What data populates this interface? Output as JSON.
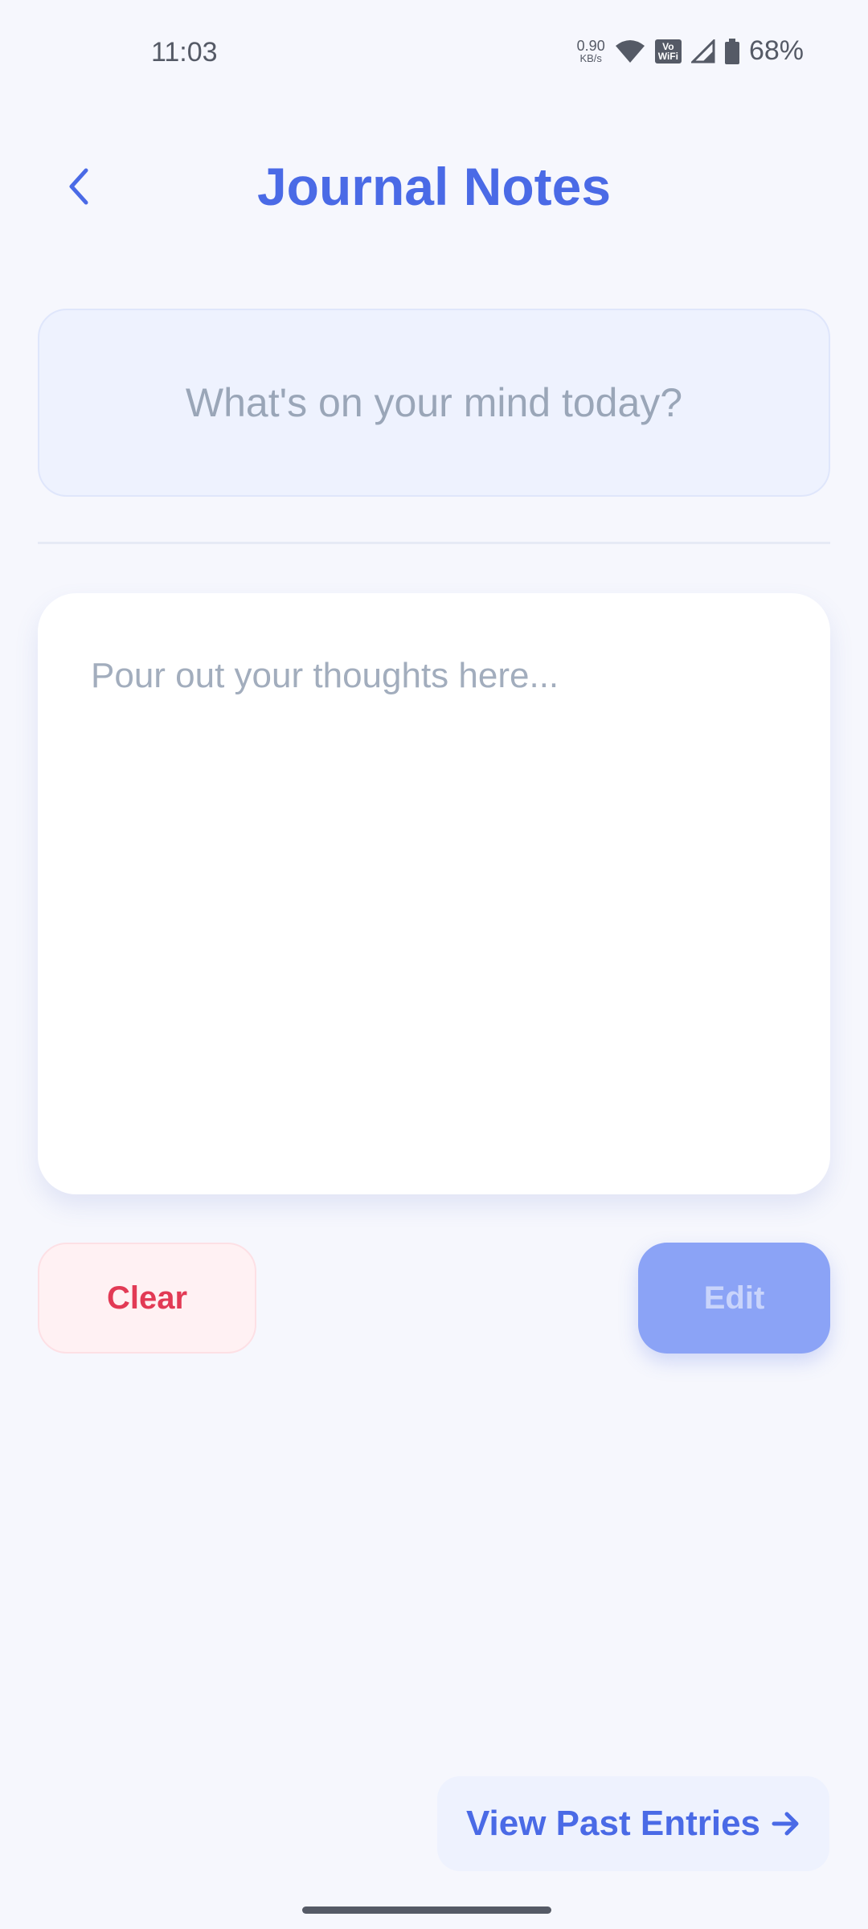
{
  "status_bar": {
    "time": "11:03",
    "net_speed_value": "0.90",
    "net_speed_unit": "KB/s",
    "vowifi_top": "Vo",
    "vowifi_bottom": "WiFi",
    "battery": "68%"
  },
  "header": {
    "title": "Journal Notes",
    "back_icon": "chevron-left-icon"
  },
  "prompt": {
    "text": "What's on your mind today?"
  },
  "entry": {
    "value": "",
    "placeholder": "Pour out your thoughts here..."
  },
  "actions": {
    "clear_label": "Clear",
    "edit_label": "Edit"
  },
  "footer": {
    "view_past_label": "View Past Entries",
    "view_past_icon": "arrow-right-icon"
  },
  "colors": {
    "accent": "#4a6ae6",
    "danger": "#e23a55",
    "background": "#f6f7fd"
  }
}
